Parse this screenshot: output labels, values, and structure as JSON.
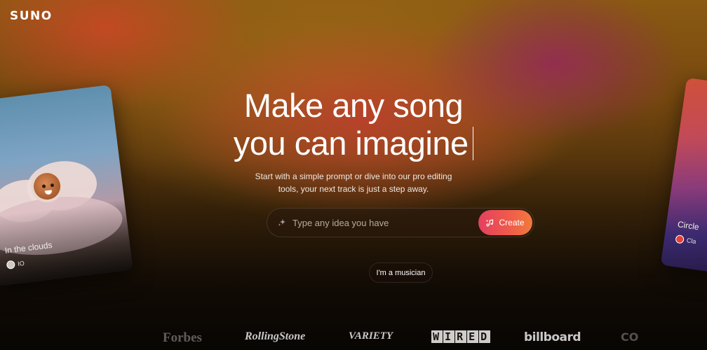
{
  "brand": {
    "logo": "SUNO"
  },
  "hero": {
    "title_line1": "Make any song",
    "title_line2": "you can imagine",
    "subtitle_line1": "Start with a simple prompt or dive into our pro editing",
    "subtitle_line2": "tools, your next track is just a step away."
  },
  "prompt": {
    "placeholder": "Type any idea you have",
    "value": "",
    "icon": "sparkle-icon",
    "create_label": "Create",
    "create_icon": "music-note-sparkle-icon"
  },
  "musician_button": "I'm a musician",
  "cards": {
    "left": {
      "title": "In the clouds",
      "artist": "IO"
    },
    "right": {
      "title": "Circle",
      "artist": "Cla"
    }
  },
  "press": {
    "forbes": "Forbes",
    "rolling_stone": "RollingStone",
    "variety": "VARIETY",
    "wired": [
      "W",
      "I",
      "R",
      "E",
      "D"
    ],
    "billboard": "billboard",
    "partial": "CO"
  },
  "colors": {
    "create_gradient_start": "#e4405f",
    "create_gradient_end": "#f07a3c",
    "background_top": "#8a5a12",
    "background_bottom": "#120c06"
  }
}
